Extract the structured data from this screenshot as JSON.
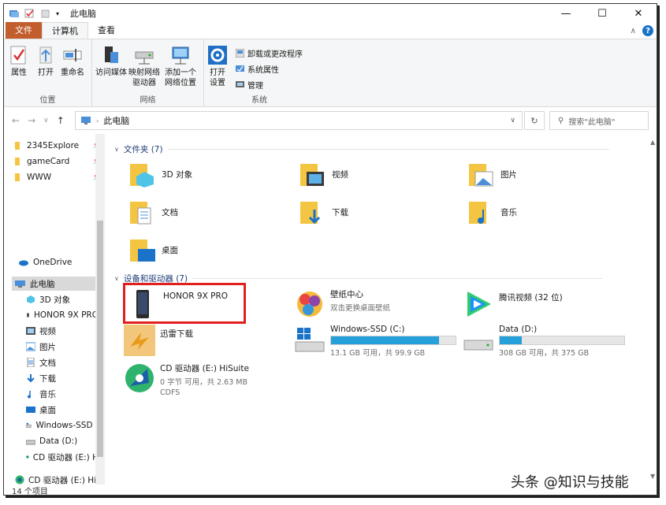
{
  "window": {
    "title": "此电脑"
  },
  "window_controls": {
    "minimize": "—",
    "maximize": "☐",
    "close": "✕"
  },
  "tabs": {
    "file": "文件",
    "computer": "计算机",
    "view": "查看",
    "expand": "∧",
    "help": "?"
  },
  "ribbon": {
    "location": {
      "label": "位置",
      "properties": "属性",
      "open": "打开",
      "rename": "重命名"
    },
    "network": {
      "label": "网络",
      "access_media": "访问媒体",
      "map_drive_1": "映射网络",
      "map_drive_2": "驱动器",
      "add_location_1": "添加一个",
      "add_location_2": "网络位置"
    },
    "system": {
      "label": "系统",
      "open_settings_1": "打开",
      "open_settings_2": "设置",
      "uninstall": "卸载或更改程序",
      "system_props": "系统属性",
      "manage": "管理"
    }
  },
  "nav": {
    "back": "←",
    "forward": "→",
    "recent": "∨",
    "up": "↑",
    "breadcrumb": "此电脑",
    "refresh": "↻",
    "search_placeholder": "搜索\"此电脑\""
  },
  "sidebar": {
    "quick": [
      {
        "label": "2345Explore"
      },
      {
        "label": "gameCard"
      },
      {
        "label": "WWW"
      }
    ],
    "onedrive": "OneDrive",
    "thispc": "此电脑",
    "items": [
      {
        "label": "3D 对象"
      },
      {
        "label": "HONOR 9X PRO"
      },
      {
        "label": "视频"
      },
      {
        "label": "图片"
      },
      {
        "label": "文档"
      },
      {
        "label": "下载"
      },
      {
        "label": "音乐"
      },
      {
        "label": "桌面"
      },
      {
        "label": "Windows-SSD ("
      },
      {
        "label": "Data (D:)"
      },
      {
        "label": "CD 驱动器 (E:) H"
      },
      {
        "label": "CD 驱动器 (E:) HiS"
      }
    ]
  },
  "folders_section": {
    "title": "文件夹 (7)"
  },
  "folders": [
    {
      "label": "3D 对象"
    },
    {
      "label": "视频"
    },
    {
      "label": "图片"
    },
    {
      "label": "文档"
    },
    {
      "label": "下载"
    },
    {
      "label": "音乐"
    },
    {
      "label": "桌面"
    }
  ],
  "devices_section": {
    "title": "设备和驱动器 (7)"
  },
  "devices": {
    "honor": {
      "name": "HONOR 9X PRO"
    },
    "wallpaper": {
      "name": "壁纸中心",
      "sub": "双击更换桌面壁纸"
    },
    "tencent": {
      "name": "腾讯视频 (32 位)"
    },
    "thunder": {
      "name": "迅雷下载"
    },
    "windows_ssd": {
      "name": "Windows-SSD (C:)",
      "sub": "13.1 GB 可用，共 99.9 GB",
      "used_fraction": 0.87
    },
    "data_d": {
      "name": "Data (D:)",
      "sub": "308 GB 可用，共 375 GB",
      "used_fraction": 0.18
    },
    "cd": {
      "name": "CD 驱动器 (E:) HiSuite",
      "sub": "0 字节 可用，共 2.63 MB",
      "sub2": "CDFS"
    }
  },
  "status": {
    "count": "14 个项目"
  },
  "watermark": "头条 @知识与技能",
  "colors": {
    "accent": "#26a0da",
    "file_tab": "#c25d2e",
    "highlight": "#e0201f"
  }
}
